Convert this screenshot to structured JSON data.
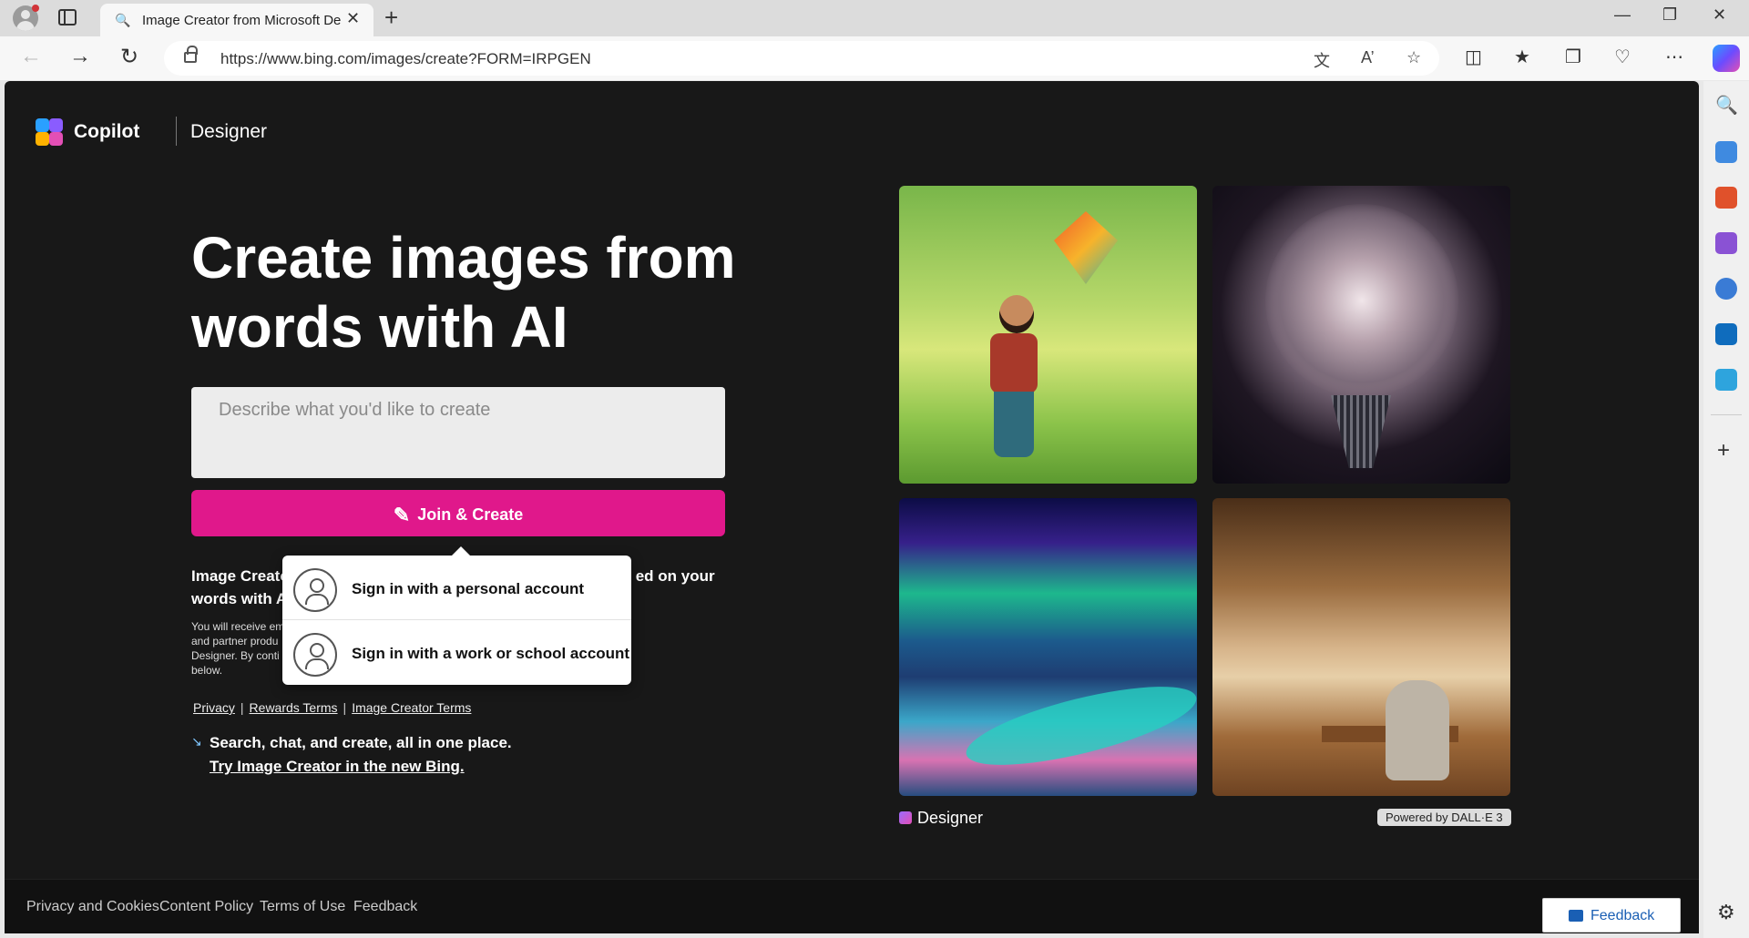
{
  "browser": {
    "tab_title": "Image Creator from Microsoft Designer",
    "tab_icon": "search-icon",
    "url": "https://www.bing.com/images/create?FORM=IRPGEN"
  },
  "header": {
    "brand_name": "Copilot",
    "product_name": "Designer"
  },
  "hero": {
    "title": "Create images from words with AI"
  },
  "prompt": {
    "placeholder": "Describe what you'd like to create"
  },
  "join_button": {
    "label": "Join & Create"
  },
  "info": {
    "bold_start": "Image Creato",
    "bold_end": "ed on your",
    "bold_line2": "words with A",
    "small_lines": [
      "You will receive em",
      "and partner produ",
      "Designer. By conti",
      "below."
    ]
  },
  "links": [
    "Privacy",
    "Rewards Terms",
    "Image Creator Terms"
  ],
  "promo": {
    "text": "Search, chat, and create, all in one place.",
    "link": "Try Image Creator in the new Bing."
  },
  "signin_popup": {
    "personal": "Sign in with a personal account",
    "work": "Sign in with a work or school account"
  },
  "gallery": {
    "designer_label": "Designer",
    "powered_by": "Powered by DALL·E 3"
  },
  "footer": {
    "links": [
      "Privacy and Cookies",
      "Content Policy",
      "Terms of Use",
      "Feedback"
    ],
    "feedback_button": "Feedback"
  },
  "colors": {
    "accent": "#e0188b",
    "page_bg": "#181818",
    "feedback_blue": "#1a5fb4"
  }
}
